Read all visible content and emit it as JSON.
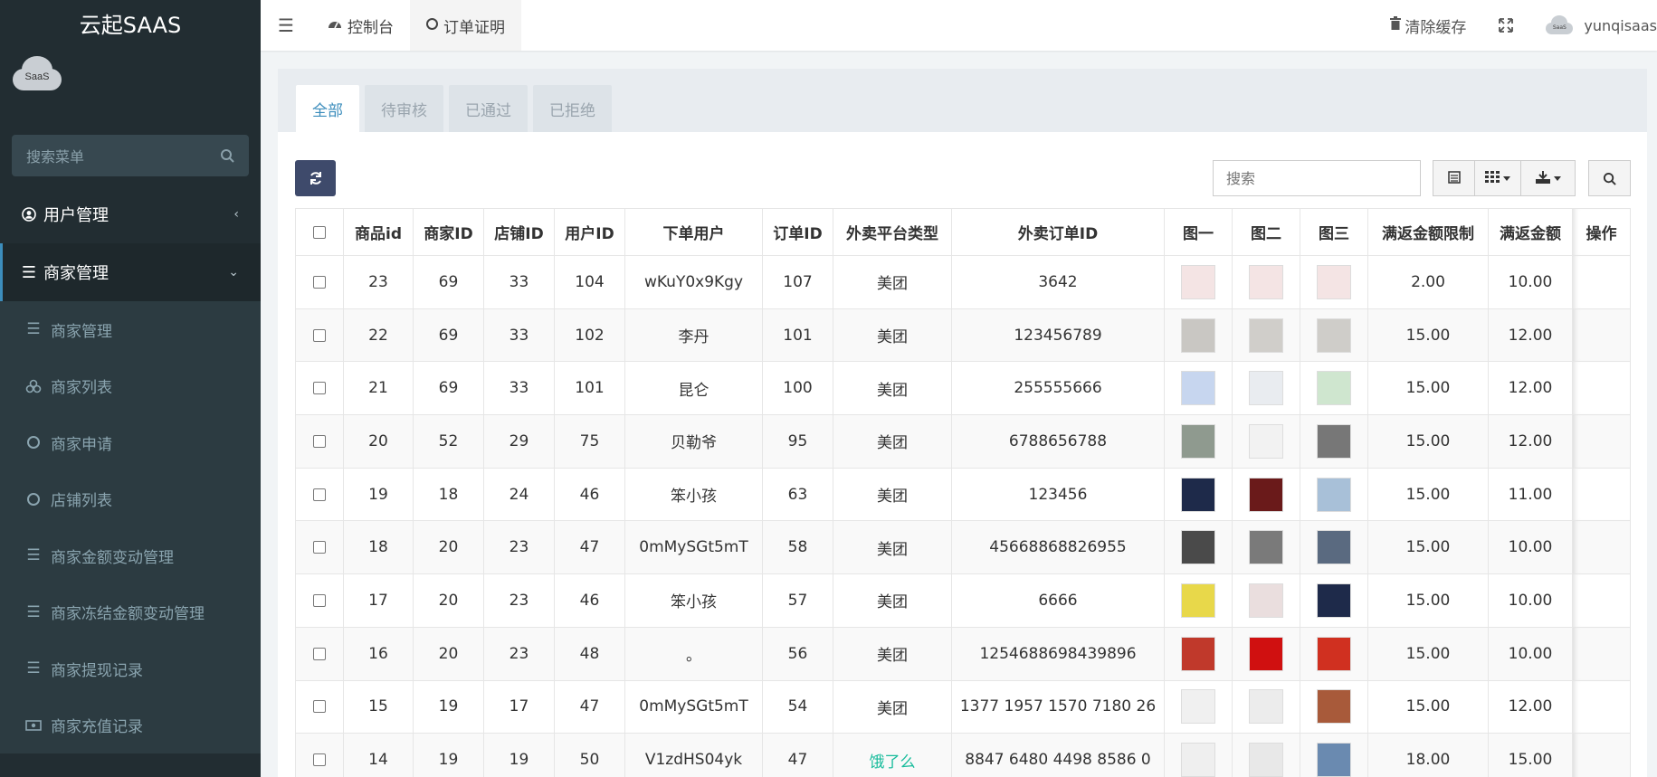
{
  "sidebar": {
    "brand": "云起SAAS",
    "avatar_text": "SaaS",
    "search_placeholder": "搜索菜单",
    "menu": [
      {
        "label": "用户管理",
        "icon": "user-circle-icon",
        "expanded": false
      },
      {
        "label": "商家管理",
        "icon": "list-icon",
        "expanded": true
      }
    ],
    "submenu": [
      {
        "label": "商家管理",
        "icon": "list-icon"
      },
      {
        "label": "商家列表",
        "icon": "cubes-icon"
      },
      {
        "label": "商家申请",
        "icon": "circle-icon"
      },
      {
        "label": "店铺列表",
        "icon": "circle-icon"
      },
      {
        "label": "商家金额变动管理",
        "icon": "list-icon"
      },
      {
        "label": "商家冻结金额变动管理",
        "icon": "list-icon"
      },
      {
        "label": "商家提现记录",
        "icon": "list-icon"
      },
      {
        "label": "商家充值记录",
        "icon": "money-icon"
      }
    ]
  },
  "header": {
    "tabs": [
      {
        "label": "控制台",
        "icon": "dashboard-icon"
      },
      {
        "label": "订单证明",
        "icon": "circle-icon",
        "active": true
      }
    ],
    "clear_cache": "清除缓存",
    "username": "yunqisaas",
    "avatar_text": "SaaS"
  },
  "status_tabs": [
    {
      "label": "全部",
      "active": true
    },
    {
      "label": "待审核"
    },
    {
      "label": "已通过"
    },
    {
      "label": "已拒绝"
    }
  ],
  "toolbar": {
    "search_placeholder": "搜索"
  },
  "table": {
    "columns": [
      "商品id",
      "商家ID",
      "店铺ID",
      "用户ID",
      "下单用户",
      "订单ID",
      "外卖平台类型",
      "外卖订单ID",
      "图一",
      "图二",
      "图三",
      "满返金额限制",
      "满返金额",
      "操作"
    ],
    "rows": [
      {
        "cells": [
          "23",
          "69",
          "33",
          "104",
          "wKuY0x9Kgy",
          "107",
          "美团",
          "3642",
          "2.00",
          "10.00"
        ],
        "imgs": [
          "#f4e4e4",
          "#f4e4e4",
          "#f4e4e4"
        ]
      },
      {
        "cells": [
          "22",
          "69",
          "33",
          "102",
          "李丹",
          "101",
          "美团",
          "123456789",
          "15.00",
          "12.00"
        ],
        "imgs": [
          "#c9c7c3",
          "#d0ceca",
          "#cfcdc9"
        ]
      },
      {
        "cells": [
          "21",
          "69",
          "33",
          "101",
          "昆仑",
          "100",
          "美团",
          "255555666",
          "15.00",
          "12.00"
        ],
        "imgs": [
          "#c7d6ef",
          "#e9ecf0",
          "#cfe6cf"
        ]
      },
      {
        "cells": [
          "20",
          "52",
          "29",
          "75",
          "贝勒爷",
          "95",
          "美团",
          "6788656788",
          "15.00",
          "12.00"
        ],
        "imgs": [
          "#8f9a8f",
          "#f2f2f2",
          "#777777"
        ]
      },
      {
        "cells": [
          "19",
          "18",
          "24",
          "46",
          "笨小孩",
          "63",
          "美团",
          "123456",
          "15.00",
          "11.00"
        ],
        "imgs": [
          "#1e2a4a",
          "#6a1a1a",
          "#a8c0d8"
        ]
      },
      {
        "cells": [
          "18",
          "20",
          "23",
          "47",
          "0mMySGt5mT",
          "58",
          "美团",
          "45668868826955",
          "15.00",
          "10.00"
        ],
        "imgs": [
          "#4a4a4a",
          "#7a7a7a",
          "#5a6a80"
        ]
      },
      {
        "cells": [
          "17",
          "20",
          "23",
          "46",
          "笨小孩",
          "57",
          "美团",
          "6666",
          "15.00",
          "10.00"
        ],
        "imgs": [
          "#e8d84a",
          "#eadede",
          "#1e2a4a"
        ]
      },
      {
        "cells": [
          "16",
          "20",
          "23",
          "48",
          "。",
          "56",
          "美团",
          "1254688698439896",
          "15.00",
          "10.00"
        ],
        "imgs": [
          "#c0392b",
          "#d01010",
          "#d03020"
        ]
      },
      {
        "cells": [
          "15",
          "19",
          "17",
          "47",
          "0mMySGt5mT",
          "54",
          "美团",
          "1377 1957 1570 7180 26",
          "15.00",
          "12.00"
        ],
        "imgs": [
          "#f0f0f0",
          "#ececec",
          "#a85a3a"
        ]
      },
      {
        "cells": [
          "14",
          "19",
          "19",
          "50",
          "V1zdHS04yk",
          "47",
          "饿了么",
          "8847 6480 4498 8586 0",
          "18.00",
          "15.00"
        ],
        "imgs": [
          "#efefef",
          "#e8e8e8",
          "#6a8ab0"
        ]
      }
    ]
  }
}
